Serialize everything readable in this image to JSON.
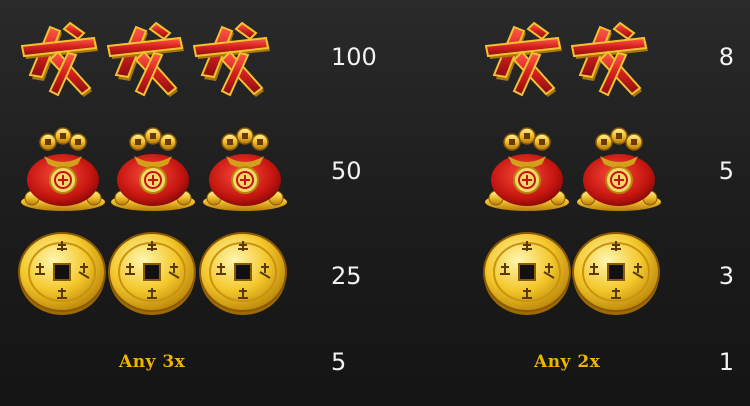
{
  "paytable": {
    "left": {
      "count": 3,
      "rows": [
        {
          "symbol": "fa-character-icon",
          "payout": "100"
        },
        {
          "symbol": "money-bag-icon",
          "payout": "50"
        },
        {
          "symbol": "gold-coin-icon",
          "payout": "25"
        }
      ],
      "any_label": "Any 3x",
      "any_payout": "5"
    },
    "right": {
      "count": 2,
      "rows": [
        {
          "symbol": "fa-character-icon",
          "payout": "8"
        },
        {
          "symbol": "money-bag-icon",
          "payout": "5"
        },
        {
          "symbol": "gold-coin-icon",
          "payout": "3"
        }
      ],
      "any_label": "Any 2x",
      "any_payout": "1"
    }
  },
  "colors": {
    "background": "#1c1c1c",
    "payout_text": "#f2f2f2",
    "any_label": "#f0b400",
    "symbol_red": "#d41f1f",
    "symbol_gold": "#f2c230"
  }
}
